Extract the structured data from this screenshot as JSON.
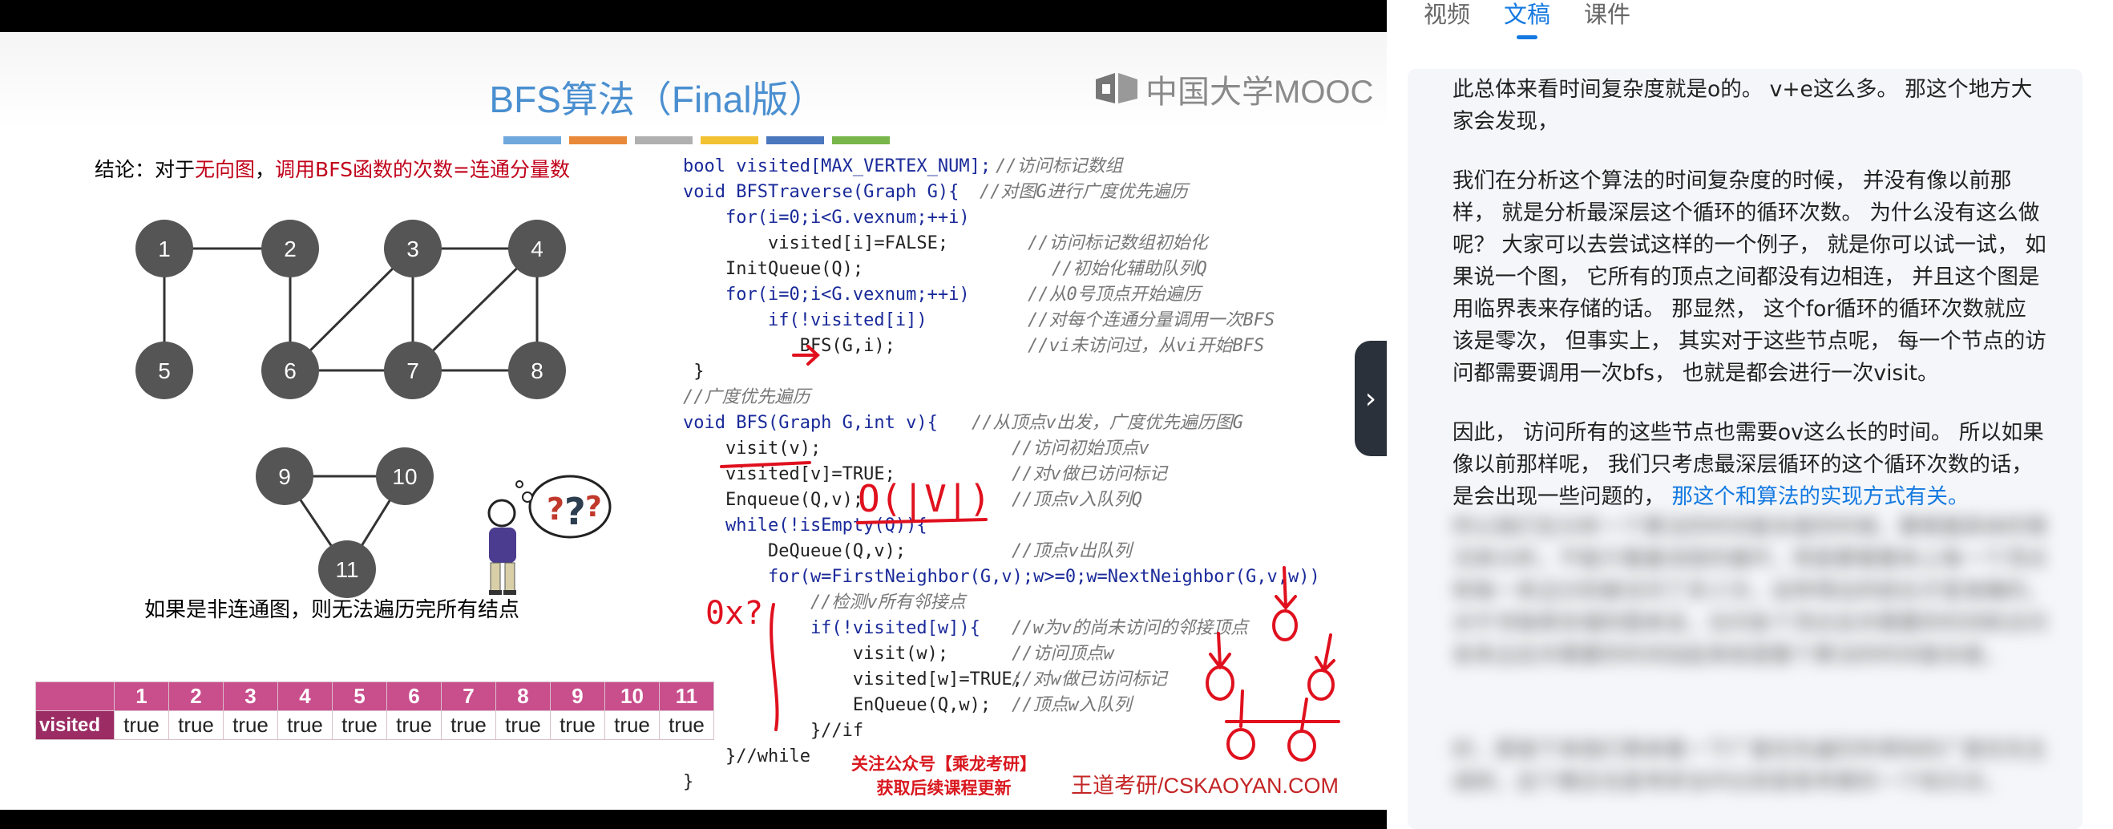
{
  "slide": {
    "title": "BFS算法（Final版）",
    "logo_text": "中国大学MOOC",
    "color_bar": [
      "#6fa8dc",
      "#e8893a",
      "#b0b0b0",
      "#f2c232",
      "#4b77be",
      "#78b54a"
    ],
    "conclusion_prefix": "结论：对于",
    "conclusion_red1": "无向图",
    "conclusion_mid": "，",
    "conclusion_red2": "调用BFS函数的次数=连通分量数",
    "non_connected_note": "如果是非连通图，则无法遍历完所有结点",
    "graph_nodes": [
      "1",
      "2",
      "3",
      "4",
      "5",
      "6",
      "7",
      "8",
      "9",
      "10",
      "11"
    ],
    "table": {
      "label": "visited",
      "indices": [
        "1",
        "2",
        "3",
        "4",
        "5",
        "6",
        "7",
        "8",
        "9",
        "10",
        "11"
      ],
      "values": [
        "true",
        "true",
        "true",
        "true",
        "true",
        "true",
        "true",
        "true",
        "true",
        "true",
        "true"
      ]
    },
    "code": [
      {
        "code": "bool visited[MAX_VERTEX_NUM];",
        "comment": "//访问标记数组"
      },
      {
        "code": "void BFSTraverse(Graph G){",
        "comment": "//对图G进行广度优先遍历"
      },
      {
        "code": "    for(i=0;i<G.vexnum;++i)",
        "comment": ""
      },
      {
        "code": "        visited[i]=FALSE;",
        "comment": "//访问标记数组初始化"
      },
      {
        "code": "    InitQueue(Q);",
        "comment": "//初始化辅助队列Q"
      },
      {
        "code": "    for(i=0;i<G.vexnum;++i)",
        "comment": "//从0号顶点开始遍历"
      },
      {
        "code": "        if(!visited[i])",
        "comment": "//对每个连通分量调用一次BFS"
      },
      {
        "code": "           BFS(G,i);",
        "comment": "//vi未访问过，从vi开始BFS"
      },
      {
        "code": " }",
        "comment": ""
      },
      {
        "code": "//广度优先遍历",
        "comment": ""
      },
      {
        "code": "void BFS(Graph G,int v){",
        "comment": "//从顶点v出发，广度优先遍历图G"
      },
      {
        "code": "    visit(v);",
        "comment": "//访问初始顶点v"
      },
      {
        "code": "    visited[v]=TRUE;",
        "comment": "//对v做已访问标记"
      },
      {
        "code": "    Enqueue(Q,v);",
        "comment": "//顶点v入队列Q"
      },
      {
        "code": "    while(!isEmpty(Q)){",
        "comment": ""
      },
      {
        "code": "        DeQueue(Q,v);",
        "comment": "//顶点v出队列"
      },
      {
        "code": "        for(w=FirstNeighbor(G,v);w>=0;w=NextNeighbor(G,v,w))",
        "comment": ""
      },
      {
        "code": "            //检测v所有邻接点",
        "comment": ""
      },
      {
        "code": "            if(!visited[w]){",
        "comment": "//w为v的尚未访问的邻接顶点"
      },
      {
        "code": "                visit(w);",
        "comment": "//访问顶点w"
      },
      {
        "code": "                visited[w]=TRUE;",
        "comment": "//对w做已访问标记"
      },
      {
        "code": "                EnQueue(Q,w);",
        "comment": "//顶点w入队列"
      },
      {
        "code": "            }//if",
        "comment": ""
      },
      {
        "code": "    }//while",
        "comment": ""
      },
      {
        "code": "}",
        "comment": ""
      }
    ],
    "handwriting_big_o": "O(|V|)",
    "handwriting_left": "0x?",
    "promo_line1": "关注公众号【乘龙考研】",
    "promo_line2": "获取后续课程更新",
    "watermark": "王道考研/CSKAOYAN.COM"
  },
  "panel": {
    "tabs": [
      {
        "label": "视频",
        "active": false
      },
      {
        "label": "文稿",
        "active": true
      },
      {
        "label": "课件",
        "active": false
      }
    ],
    "transcript": {
      "p1": "此总体来看时间复杂度就是o的。 v+e这么多。 那这个地方大家会发现，",
      "p2": "我们在分析这个算法的时间复杂度的时候， 并没有像以前那样， 就是分析最深层这个循环的循环次数。 为什么没有这么做呢？ 大家可以去尝试这样的一个例子， 就是你可以试一试， 如果说一个图， 它所有的顶点之间都没有边相连， 并且这个图是用临界表来存储的话。 那显然， 这个for循环的循环次数就应该是零次， 但事实上， 其实对于这些节点呢， 每一个节点的访问都需要调用一次bfs， 也就是都会进行一次visit。",
      "p3": "因此， 访问所有的这些节点也需要ov这么长的时间。 所以如果像以前那样呢， 我们只考虑最深层循环的这个循环次数的话，",
      "p3_tail": "是会出现一些问题的，",
      "p3_highlight": "那这个和算法的实现方式有关。",
      "blur1": "所以我们在分析一个算法的时间复杂度的时候，要根据具体的情况来分析，不能只看最深层的循环，而是要看整体上每一个顶点和每一条边分别被访问了多少次，这样得出的结论才是准确的。对于邻接表存储的图来说，访问各个顶点总共需要的时间和访问各条边总共需要的时间加起来就是整个算法的时间复杂度。",
      "blur2": "好，那接下来我们再来看一下广度优先遍历所得到的广度优先生成树，这个概念也是考研当中比较容易考察的一个知识点。"
    }
  }
}
